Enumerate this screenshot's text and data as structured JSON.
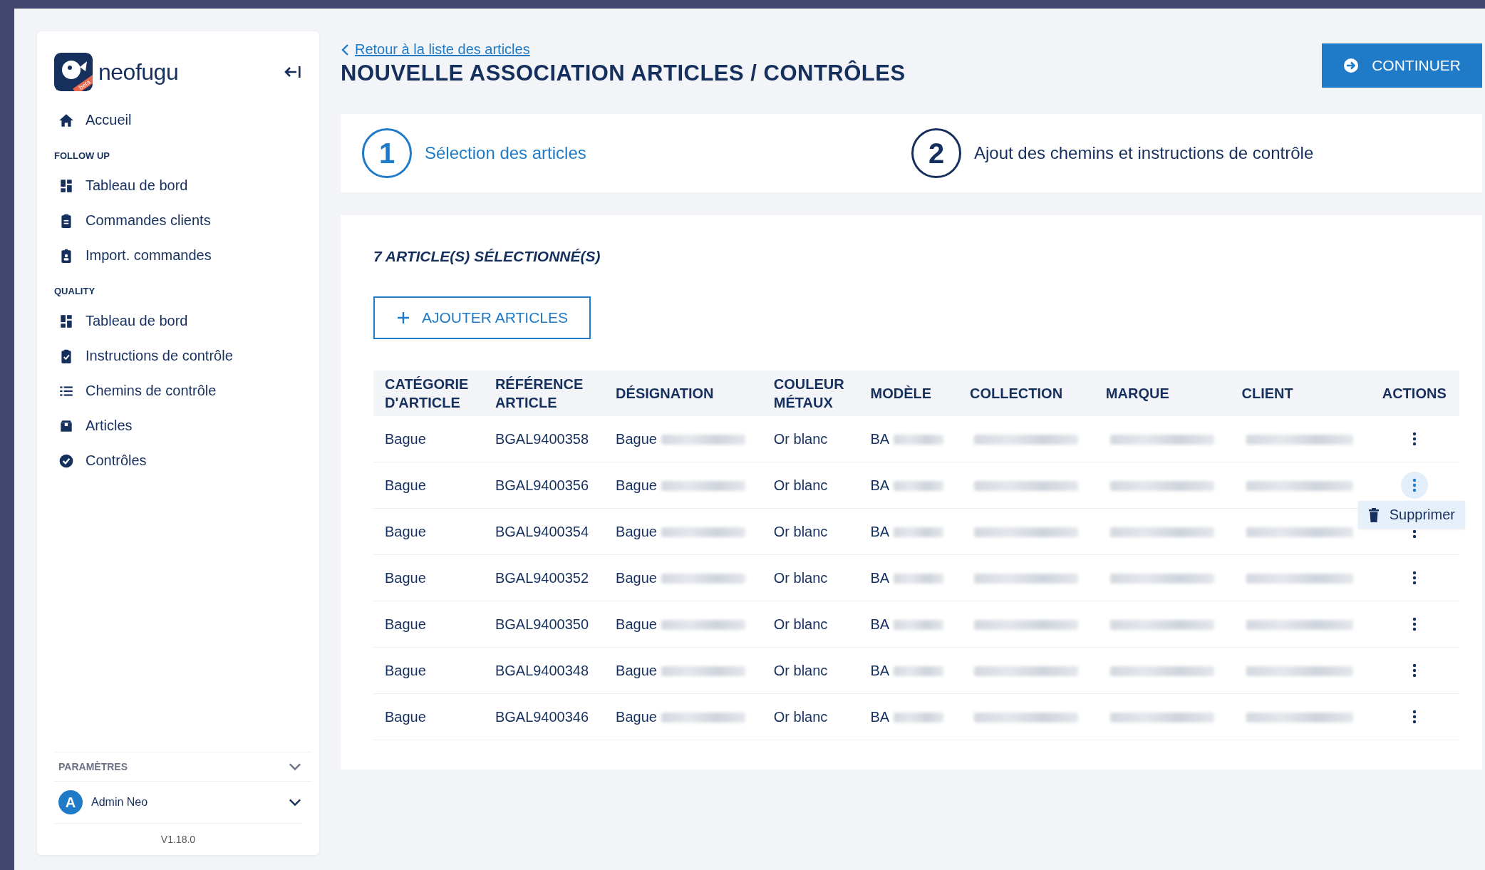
{
  "sidebar": {
    "logo": {
      "name": "neofugu",
      "badge": "beta"
    },
    "items": [
      {
        "label": "Accueil",
        "kind": "home",
        "selected": false
      }
    ],
    "sections": [
      {
        "title": "FOLLOW UP",
        "items": [
          {
            "label": "Tableau de bord",
            "kind": "dashboard",
            "selected": false
          },
          {
            "label": "Commandes clients",
            "kind": "orders",
            "selected": false
          },
          {
            "label": "Import. commandes",
            "kind": "import",
            "selected": false
          }
        ]
      },
      {
        "title": "QUALITY",
        "items": [
          {
            "label": "Tableau de bord",
            "kind": "dashboard",
            "selected": false
          },
          {
            "label": "Instructions de contrôle",
            "kind": "instructions",
            "selected": false
          },
          {
            "label": "Chemins de contrôle",
            "kind": "paths",
            "selected": false
          },
          {
            "label": "Articles",
            "kind": "articles",
            "selected": false
          },
          {
            "label": "Contrôles",
            "kind": "controls",
            "selected": false
          }
        ]
      }
    ],
    "settings": {
      "label": "PARAMÈTRES",
      "expanded": false
    },
    "user": {
      "initial": "A",
      "name": "Admin Neo",
      "expanded": false
    },
    "version": "V1.18.0"
  },
  "header": {
    "back_link": "Retour à la liste des articles",
    "title": "NOUVELLE ASSOCIATION ARTICLES / CONTRÔLES",
    "continue_button": "CONTINUER"
  },
  "steps": [
    {
      "number": "1",
      "label": "Sélection des articles",
      "selected": true
    },
    {
      "number": "2",
      "label": "Ajout des chemins et instructions de contrôle",
      "selected": false
    }
  ],
  "selection": {
    "title": "7 ARTICLE(S) SÉLECTIONNÉ(S)",
    "add_button": "AJOUTER ARTICLES"
  },
  "table": {
    "columns": [
      [
        "CATÉGORIE",
        "D'ARTICLE"
      ],
      [
        "RÉFÉRENCE",
        "ARTICLE"
      ],
      [
        "DÉSIGNATION"
      ],
      [
        "COULEUR",
        "MÉTAUX"
      ],
      [
        "MODÈLE"
      ],
      [
        "COLLECTION"
      ],
      [
        "MARQUE"
      ],
      [
        "CLIENT"
      ],
      [
        "ACTIONS"
      ]
    ],
    "rows": [
      {
        "category": "Bague",
        "reference": "BGAL9400358",
        "designation": "Bague",
        "metal": "Or blanc",
        "model": "BA",
        "menu_open": false
      },
      {
        "category": "Bague",
        "reference": "BGAL9400356",
        "designation": "Bague",
        "metal": "Or blanc",
        "model": "BA",
        "menu_open": true
      },
      {
        "category": "Bague",
        "reference": "BGAL9400354",
        "designation": "Bague",
        "metal": "Or blanc",
        "model": "BA",
        "menu_open": false
      },
      {
        "category": "Bague",
        "reference": "BGAL9400352",
        "designation": "Bague",
        "metal": "Or blanc",
        "model": "BA",
        "menu_open": false
      },
      {
        "category": "Bague",
        "reference": "BGAL9400350",
        "designation": "Bague",
        "metal": "Or blanc",
        "model": "BA",
        "menu_open": false
      },
      {
        "category": "Bague",
        "reference": "BGAL9400348",
        "designation": "Bague",
        "metal": "Or blanc",
        "model": "BA",
        "menu_open": false
      },
      {
        "category": "Bague",
        "reference": "BGAL9400346",
        "designation": "Bague",
        "metal": "Or blanc",
        "model": "BA",
        "menu_open": false
      }
    ],
    "menu": {
      "items": [
        "Supprimer"
      ]
    }
  }
}
